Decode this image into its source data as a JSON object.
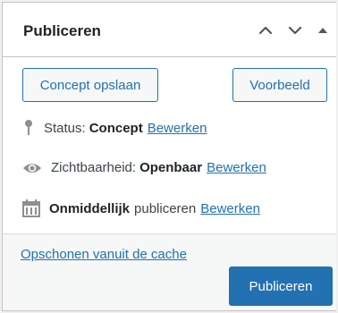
{
  "panel": {
    "title": "Publiceren",
    "controls": [
      "move-up",
      "move-down",
      "toggle-panel"
    ]
  },
  "actions": {
    "save_draft": "Concept opslaan",
    "preview": "Voorbeeld"
  },
  "status": {
    "label": "Status:",
    "value": "Concept",
    "edit": "Bewerken"
  },
  "visibility": {
    "label": "Zichtbaarheid:",
    "value": "Openbaar",
    "edit": "Bewerken"
  },
  "schedule": {
    "value": "Onmiddellijk",
    "label": "publiceren",
    "edit": "Bewerken"
  },
  "footer": {
    "cache_link": "Opschonen vanuit de cache",
    "publish": "Publiceren"
  },
  "colors": {
    "accent": "#2271b1",
    "border": "#c3c4c7",
    "text": "#3c434a"
  }
}
